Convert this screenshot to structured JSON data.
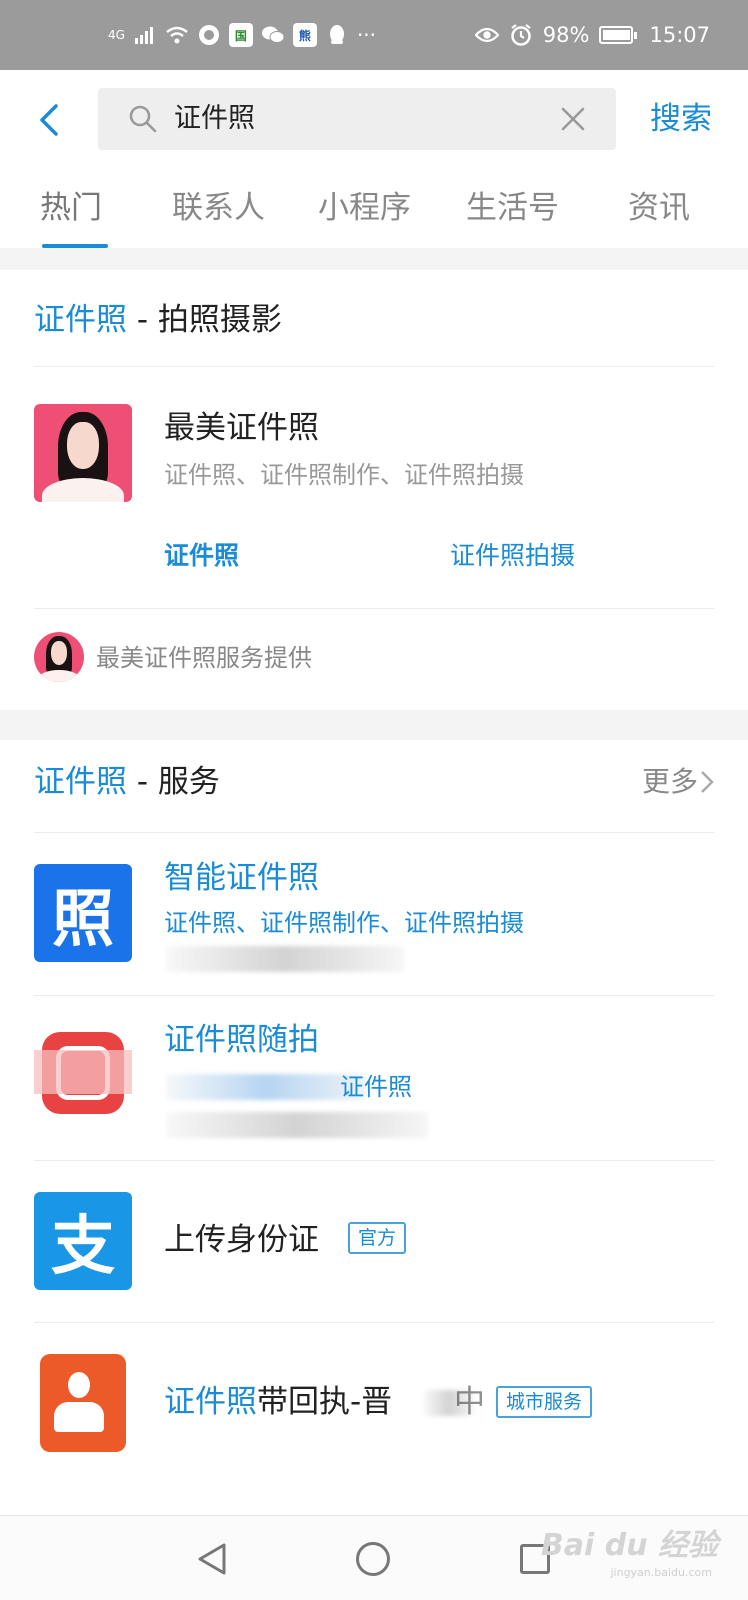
{
  "status_bar": {
    "network": "4G",
    "battery": "98%",
    "time": "15:07",
    "more": "···",
    "icons": [
      "signal-icon",
      "wifi-icon",
      "app-icon",
      "app-icon-green",
      "wechat-icon",
      "app-icon-blue",
      "qq-icon",
      "eye-icon",
      "alarm-icon",
      "battery-icon"
    ]
  },
  "header": {
    "search_query": "证件照",
    "search_button": "搜索"
  },
  "tabs": [
    "热门",
    "联系人",
    "小程序",
    "生活号",
    "资讯"
  ],
  "section1": {
    "title_highlight": "证件照",
    "title_rest": " - 拍照摄影",
    "app_name": "最美证件照",
    "app_desc": "证件照、证件照制作、证件照拍摄",
    "link1": "证件照",
    "link2": "证件照拍摄",
    "provider": "最美证件照服务提供"
  },
  "section2": {
    "title_highlight": "证件照",
    "title_rest": " - 服务",
    "more": "更多",
    "items": [
      {
        "name": "智能证件照",
        "desc": "证件照、证件照制作、证件照拍摄",
        "icon_text": "照"
      },
      {
        "name": "证件照随拍",
        "desc": "证件照"
      },
      {
        "name": "上传身份证",
        "tag": "官方",
        "icon_text": "支"
      },
      {
        "name_highlight": "证件照",
        "name_rest": "带回执-晋",
        "name_suffix": "中",
        "tag": "城市服务"
      }
    ]
  },
  "watermark": {
    "brand": "Bai du 经验",
    "url": "jingyan.baidu.com"
  },
  "colors": {
    "accent": "#1a8bd6",
    "status_bar": "#9b9b9b",
    "alipay_blue": "#1a96e6",
    "icon_red": "#e94243",
    "icon_orange": "#ec5a2a"
  }
}
